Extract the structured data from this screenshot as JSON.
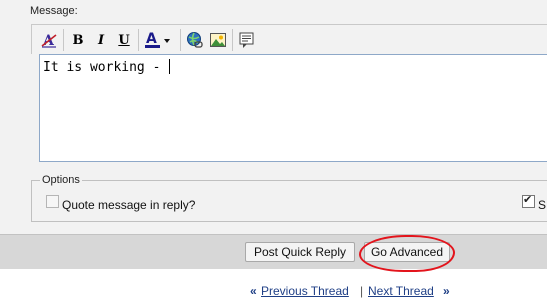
{
  "message": {
    "label": "Message:",
    "body": "It is working - "
  },
  "toolbar": {
    "buttons": [
      {
        "name": "remove-format-icon",
        "glyph": "A"
      },
      {
        "name": "bold-button",
        "glyph": "B"
      },
      {
        "name": "italic-button",
        "glyph": "I"
      },
      {
        "name": "underline-button",
        "glyph": "U"
      },
      {
        "name": "font-color-button",
        "glyph": "A"
      },
      {
        "name": "insert-link-icon",
        "glyph": "🌐"
      },
      {
        "name": "insert-image-icon",
        "glyph": "🖼"
      },
      {
        "name": "quote-icon",
        "glyph": "💬"
      }
    ],
    "font_color_accent": "#1a1a8a"
  },
  "options": {
    "legend": "Options",
    "quote_label": "Quote message in reply?",
    "quote_checked": false,
    "second_label_partial": "S",
    "second_checked": true
  },
  "buttons": {
    "post_quick_reply": "Post Quick Reply",
    "go_advanced": "Go Advanced"
  },
  "nav": {
    "left_raquo": "«",
    "previous": "Previous Thread",
    "divider": "|",
    "next": "Next Thread",
    "right_raquo": "»"
  },
  "colors": {
    "annotation_circle": "#e3141c",
    "link": "#1f3f86"
  }
}
